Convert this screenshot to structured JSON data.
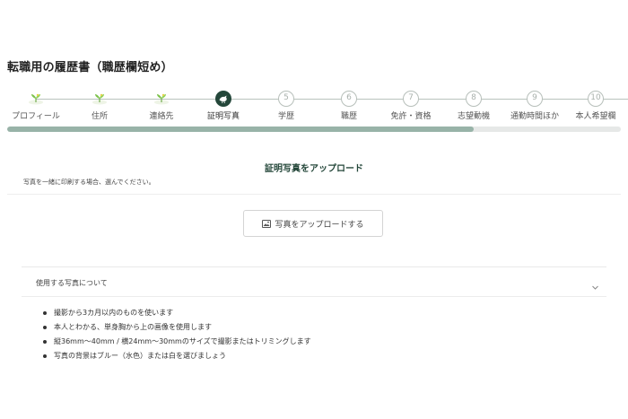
{
  "page": {
    "title": "転職用の履歴書（職歴欄短め）"
  },
  "steps": [
    {
      "num": "",
      "label": "プロフィール",
      "status": "done",
      "icon": "sprout-icon"
    },
    {
      "num": "",
      "label": "住所",
      "status": "done",
      "icon": "sprout-icon"
    },
    {
      "num": "",
      "label": "連絡先",
      "status": "done",
      "icon": "sprout-icon"
    },
    {
      "num": "",
      "label": "証明写真",
      "status": "current",
      "icon": "bird-icon"
    },
    {
      "num": "5",
      "label": "学歴",
      "status": "todo"
    },
    {
      "num": "6",
      "label": "職歴",
      "status": "todo"
    },
    {
      "num": "7",
      "label": "免許・資格",
      "status": "todo"
    },
    {
      "num": "8",
      "label": "志望動機",
      "status": "todo"
    },
    {
      "num": "9",
      "label": "通勤時間ほか",
      "status": "todo"
    },
    {
      "num": "10",
      "label": "本人希望欄",
      "status": "todo"
    }
  ],
  "progress": {
    "fraction": 0.76
  },
  "section": {
    "title": "証明写真をアップロード",
    "note": "写真を一緒に印刷する場合、選んでください。"
  },
  "upload": {
    "label": "写真をアップロードする",
    "icon": "image-icon"
  },
  "accordion": {
    "title": "使用する写真について",
    "icon": "chevron-down-icon",
    "items": [
      "撮影から3カ月以内のものを使います",
      "本人とわかる、単身胸から上の画像を使用します",
      "縦36mm～40mm / 横24mm～30mmのサイズで撮影またはトリミングします",
      "写真の背景はブルー（水色）または白を選びましょう"
    ]
  },
  "colors": {
    "accent": "#24473a",
    "progress": "#98b3a8",
    "track": "#e6e8e7",
    "sprout": "#7cc24b"
  }
}
